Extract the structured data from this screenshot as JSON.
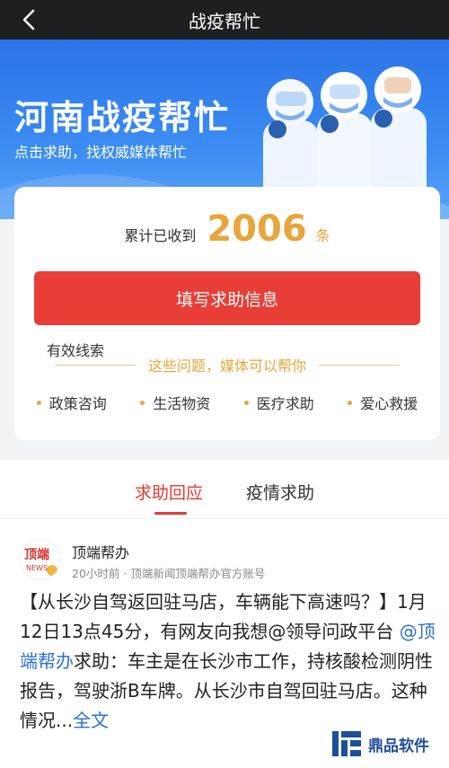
{
  "topbar": {
    "title": "战疫帮忙",
    "back_icon": "chevron-left-icon"
  },
  "banner": {
    "title": "河南战疫帮忙",
    "subtitle": "点击求助，找权威媒体帮忙"
  },
  "stats": {
    "prefix": "累计已收到",
    "count": "2006",
    "unit": "条",
    "suffix": "有效线索"
  },
  "action": {
    "button_label": "填写求助信息"
  },
  "help": {
    "heading": "这些问题，媒体可以帮你",
    "tags": [
      "政策咨询",
      "生活物资",
      "医疗求助",
      "爱心救援"
    ]
  },
  "tabs": [
    {
      "label": "求助回应",
      "active": true
    },
    {
      "label": "疫情求助",
      "active": false
    }
  ],
  "post": {
    "avatar_line1": "顶端",
    "avatar_line2": "NEWS",
    "author": "顶端帮办",
    "meta": "20小时前 · 顶端新闻顶端帮办官方账号",
    "text_before": "【从长沙自驾返回驻马店，车辆能下高速吗？】1月12日13点45分，有网友向我想@领导问政平台 ",
    "mention": "@顶端帮办",
    "text_after": "求助：车主是在长沙市工作，持核酸检测阴性报告，驾驶浙B车牌。从长沙市自驾回驻马店。这种情况...",
    "more": "全文"
  },
  "watermark": {
    "text": "鼎品软件"
  },
  "colors": {
    "accent_red": "#e83e36",
    "accent_gold": "#e7a53b",
    "banner_blue": "#2b74e8",
    "link_blue": "#2a6fd6"
  }
}
